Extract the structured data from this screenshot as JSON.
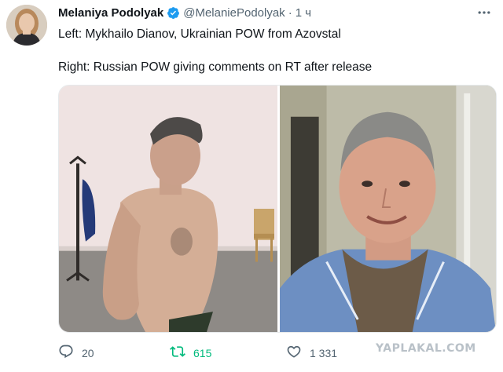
{
  "tweet": {
    "author_name": "Melaniya Podolyak",
    "handle": "@MelaniePodolyak",
    "separator": "·",
    "time": "1 ч",
    "text_line1": "Left: Mykhailo Dianov, Ukrainian POW from Azovstal",
    "text_line2": "Right: Russian POW giving comments on RT after release",
    "more_icon": "more-horizontal-icon",
    "verified_icon": "verified-badge-icon",
    "verified_color": "#1d9bf0"
  },
  "media": {
    "left_photo": "photo-left",
    "right_photo": "photo-right"
  },
  "actions": {
    "reply_count": "20",
    "retweet_count": "615",
    "like_count": "1 331",
    "retweet_color": "#00ba7c",
    "icon_color": "#536471"
  },
  "watermark": "YAPLAKAL.COM"
}
